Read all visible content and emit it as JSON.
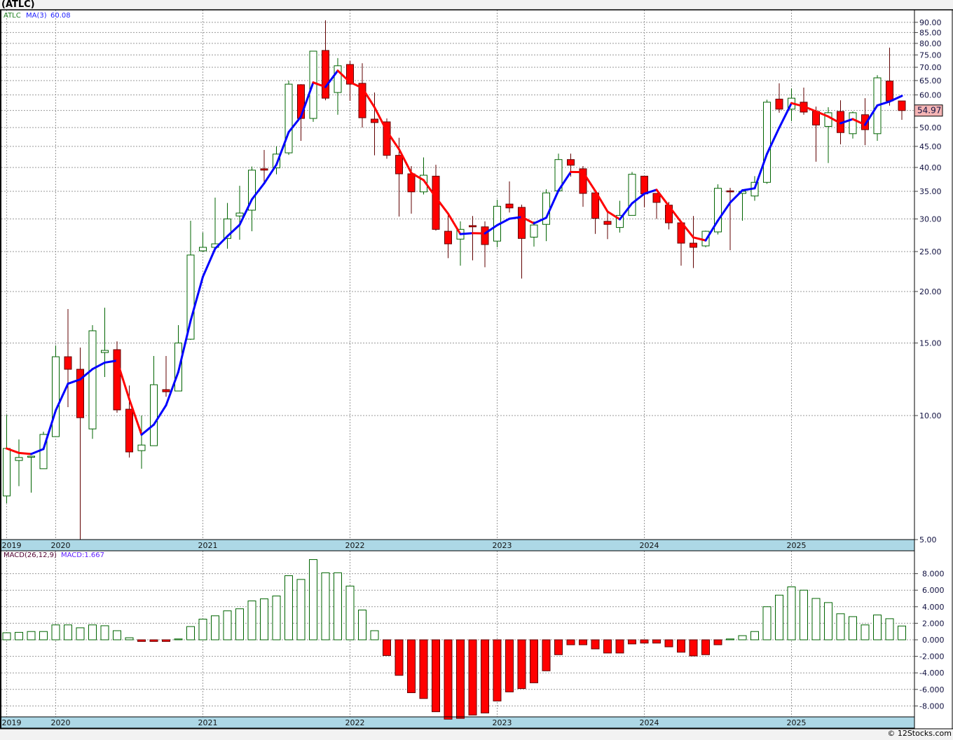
{
  "title": "(ATLC)",
  "footer": "© 12Stocks.com",
  "legend": {
    "symbol": "ATLC",
    "ma_label": "MA(3)",
    "ma_value": "60.08",
    "macd_label": "MACD(26,12,9)",
    "macd_value": "MACD:1.667"
  },
  "last_price_label": "54.97",
  "colors": {
    "up": "#006400",
    "down_fill": "#ff0000",
    "down_stroke": "#600000",
    "ma_rising": "#0000ff",
    "ma_falling": "#ff0000",
    "axis_band": "#add8e6",
    "last_price_badge": "#f4b4b4"
  },
  "chart_data": [
    {
      "type": "candlestick",
      "scale": "log",
      "ylim": [
        5,
        95
      ],
      "grid": true,
      "interval": "monthly",
      "x_start": "2019-09",
      "x_tick_labels": [
        "2019",
        "2020",
        "2021",
        "2022",
        "2023",
        "2024",
        "2025"
      ],
      "y_tick_values": [
        5,
        10,
        15,
        20,
        25,
        30,
        35,
        40,
        45,
        50,
        55,
        60,
        65,
        70,
        75,
        80,
        85,
        90
      ],
      "y_tick_labels": [
        "5.00",
        "10.00",
        "15.00",
        "20.00",
        "25.00",
        "30.00",
        "35.00",
        "40.00",
        "45.00",
        "50.00",
        "55.00",
        "60.00",
        "65.00",
        "70.00",
        "75.00",
        "80.00",
        "85.00",
        "90.00"
      ],
      "last_price": 54.97,
      "overlay": "MA(3)",
      "ohlc": [
        [
          6.38,
          10.04,
          6.13,
          8.32
        ],
        [
          7.78,
          8.75,
          6.74,
          7.91
        ],
        [
          7.94,
          7.97,
          6.5,
          7.97
        ],
        [
          7.43,
          9.14,
          7.43,
          9.0
        ],
        [
          8.89,
          14.79,
          8.89,
          13.89
        ],
        [
          13.89,
          18.13,
          10.48,
          12.95
        ],
        [
          12.95,
          14.62,
          5.0,
          9.88
        ],
        [
          9.28,
          16.57,
          8.78,
          16.06
        ],
        [
          14.22,
          18.27,
          12.4,
          14.39
        ],
        [
          14.45,
          15.14,
          10.16,
          10.32
        ],
        [
          10.36,
          11.83,
          7.91,
          8.16
        ],
        [
          8.22,
          10.0,
          7.43,
          8.48
        ],
        [
          8.45,
          13.95,
          8.45,
          11.88
        ],
        [
          11.56,
          13.95,
          11.11,
          11.42
        ],
        [
          11.47,
          16.57,
          11.47,
          15.0
        ],
        [
          15.32,
          29.7,
          15.26,
          24.52
        ],
        [
          25.1,
          27.8,
          24.9,
          25.6
        ],
        [
          25.6,
          33.8,
          25.6,
          26.1
        ],
        [
          26.9,
          32.8,
          25.4,
          30.0
        ],
        [
          30.5,
          36.1,
          26.7,
          31.0
        ],
        [
          31.5,
          40.2,
          28.0,
          39.4
        ],
        [
          39.7,
          44.1,
          36.8,
          39.4
        ],
        [
          39.9,
          45.0,
          38.5,
          43.1
        ],
        [
          43.4,
          65.0,
          42.9,
          63.7
        ],
        [
          63.5,
          63.7,
          46.4,
          52.6
        ],
        [
          52.6,
          76.6,
          51.6,
          76.6
        ],
        [
          76.9,
          91.0,
          58.2,
          58.9
        ],
        [
          60.8,
          73.7,
          53.7,
          70.6
        ],
        [
          71.1,
          72.5,
          58.0,
          63.7
        ],
        [
          64.0,
          71.6,
          50.0,
          52.8
        ],
        [
          52.4,
          60.8,
          42.8,
          51.4
        ],
        [
          51.6,
          52.6,
          42.0,
          42.8
        ],
        [
          42.8,
          47.2,
          30.4,
          38.6
        ],
        [
          38.6,
          40.3,
          30.9,
          34.9
        ],
        [
          34.9,
          42.3,
          34.4,
          38.3
        ],
        [
          38.1,
          40.6,
          28.1,
          28.3
        ],
        [
          28.0,
          31.1,
          24.1,
          26.1
        ],
        [
          26.8,
          29.6,
          23.1,
          28.3
        ],
        [
          28.9,
          30.5,
          23.8,
          28.7
        ],
        [
          28.7,
          29.6,
          22.9,
          26.0
        ],
        [
          26.5,
          33.4,
          25.6,
          32.2
        ],
        [
          32.6,
          37.0,
          31.1,
          31.9
        ],
        [
          32.0,
          32.5,
          21.5,
          26.9
        ],
        [
          27.1,
          29.6,
          25.7,
          29.0
        ],
        [
          29.1,
          35.4,
          26.5,
          34.7
        ],
        [
          35.1,
          43.2,
          35.1,
          41.8
        ],
        [
          41.8,
          43.2,
          38.0,
          40.5
        ],
        [
          39.7,
          40.3,
          32.1,
          34.6
        ],
        [
          34.7,
          34.7,
          27.6,
          30.1
        ],
        [
          29.6,
          31.2,
          26.8,
          29.1
        ],
        [
          28.6,
          33.2,
          27.8,
          30.6
        ],
        [
          30.6,
          39.0,
          30.6,
          38.5
        ],
        [
          38.1,
          38.1,
          32.0,
          34.5
        ],
        [
          34.6,
          34.6,
          30.0,
          32.9
        ],
        [
          32.4,
          33.0,
          28.3,
          29.35
        ],
        [
          29.35,
          29.35,
          23.1,
          26.2
        ],
        [
          26.2,
          30.5,
          22.8,
          25.6
        ],
        [
          25.8,
          28.1,
          25.6,
          28.0
        ],
        [
          27.9,
          36.4,
          27.5,
          35.6
        ],
        [
          35.1,
          35.7,
          25.2,
          35.0
        ],
        [
          34.6,
          35.4,
          29.7,
          35.0
        ],
        [
          34.1,
          38.1,
          33.2,
          36.8
        ],
        [
          36.8,
          58.4,
          36.5,
          57.6
        ],
        [
          58.6,
          64.0,
          54.3,
          55.4
        ],
        [
          55.4,
          62.2,
          51.8,
          58.9
        ],
        [
          57.6,
          62.5,
          53.7,
          54.5
        ],
        [
          54.7,
          56.2,
          41.3,
          50.7
        ],
        [
          50.3,
          56.0,
          41.0,
          54.3
        ],
        [
          54.7,
          58.2,
          45.5,
          48.6
        ],
        [
          48.3,
          54.7,
          47.0,
          54.3
        ],
        [
          53.7,
          58.9,
          45.3,
          49.4
        ],
        [
          48.3,
          67.0,
          46.4,
          66.0
        ],
        [
          64.8,
          78.1,
          56.5,
          58.0
        ],
        [
          58.0,
          58.0,
          52.2,
          54.97
        ]
      ]
    },
    {
      "type": "bar",
      "name": "MACD(26,12,9)",
      "ylim": [
        -10,
        10
      ],
      "grid": true,
      "x_tick_labels": [
        "2019",
        "2020",
        "2021",
        "2022",
        "2023",
        "2024",
        "2025"
      ],
      "y_tick_values": [
        8,
        6,
        4,
        2,
        0,
        -2,
        -4,
        -6,
        -8
      ],
      "y_tick_labels": [
        "8.000",
        "6.000",
        "4.000",
        "2.000",
        "0.000",
        "-2.000",
        "-4.000",
        "-6.000",
        "-8.000"
      ],
      "values": [
        0.85,
        0.9,
        1.0,
        1.0,
        1.8,
        1.8,
        1.45,
        1.8,
        1.7,
        1.1,
        0.25,
        -0.2,
        -0.2,
        -0.2,
        0.1,
        1.6,
        2.5,
        2.9,
        3.5,
        3.75,
        4.7,
        4.95,
        5.3,
        7.75,
        7.3,
        9.7,
        8.1,
        8.1,
        6.5,
        3.6,
        1.1,
        -1.9,
        -4.3,
        -6.4,
        -7.1,
        -8.7,
        -9.6,
        -9.5,
        -9.1,
        -8.85,
        -7.4,
        -6.3,
        -5.9,
        -5.2,
        -3.75,
        -1.8,
        -0.6,
        -0.6,
        -1.1,
        -1.6,
        -1.6,
        -0.5,
        -0.4,
        -0.4,
        -0.85,
        -1.5,
        -1.95,
        -1.8,
        -0.6,
        0.1,
        0.5,
        1.0,
        4.0,
        5.4,
        6.4,
        6.0,
        5.0,
        4.5,
        3.15,
        2.8,
        1.8,
        3.0,
        2.55,
        1.667
      ]
    }
  ]
}
